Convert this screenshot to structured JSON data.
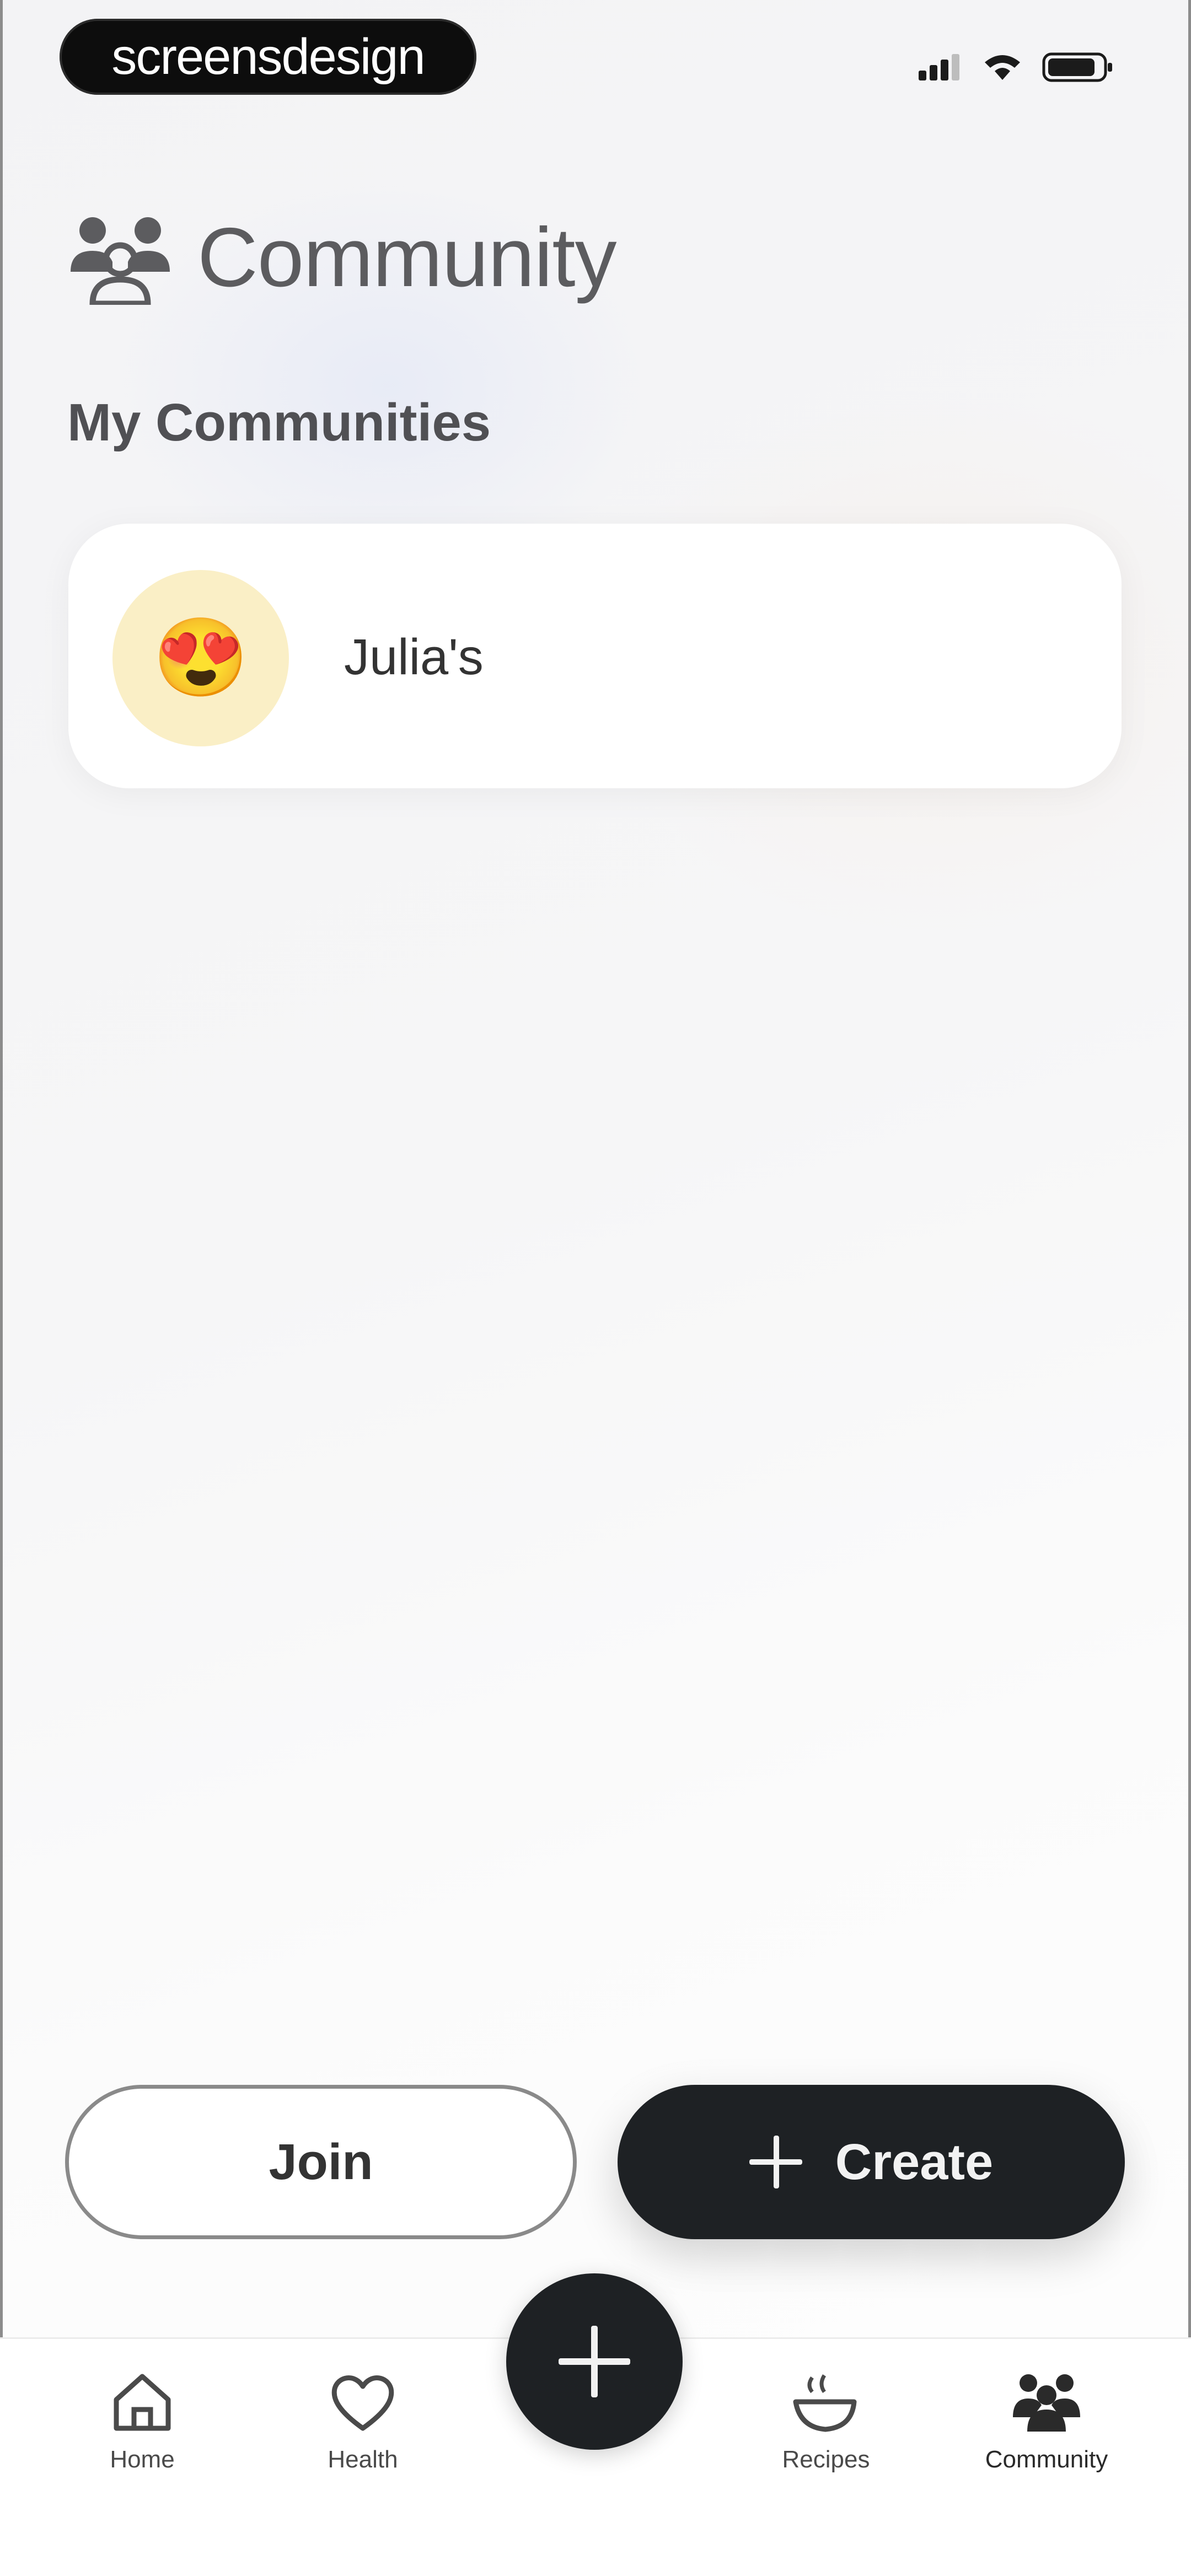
{
  "watermark": "screensdesign",
  "header": {
    "title": "Community",
    "icon": "community-icon"
  },
  "section_title": "My Communities",
  "communities": [
    {
      "name": "Julia's",
      "emoji": "😍",
      "avatar_color": "#faefc6"
    }
  ],
  "actions": {
    "join_label": "Join",
    "create_label": "Create"
  },
  "tabs": [
    {
      "label": "Home",
      "icon": "home-icon"
    },
    {
      "label": "Health",
      "icon": "heart-icon"
    },
    {
      "label": "Recipes",
      "icon": "recipes-icon"
    },
    {
      "label": "Community",
      "icon": "community-icon",
      "active": true
    }
  ],
  "colors": {
    "dark": "#1e2124",
    "accent_avatar": "#faefc6"
  }
}
